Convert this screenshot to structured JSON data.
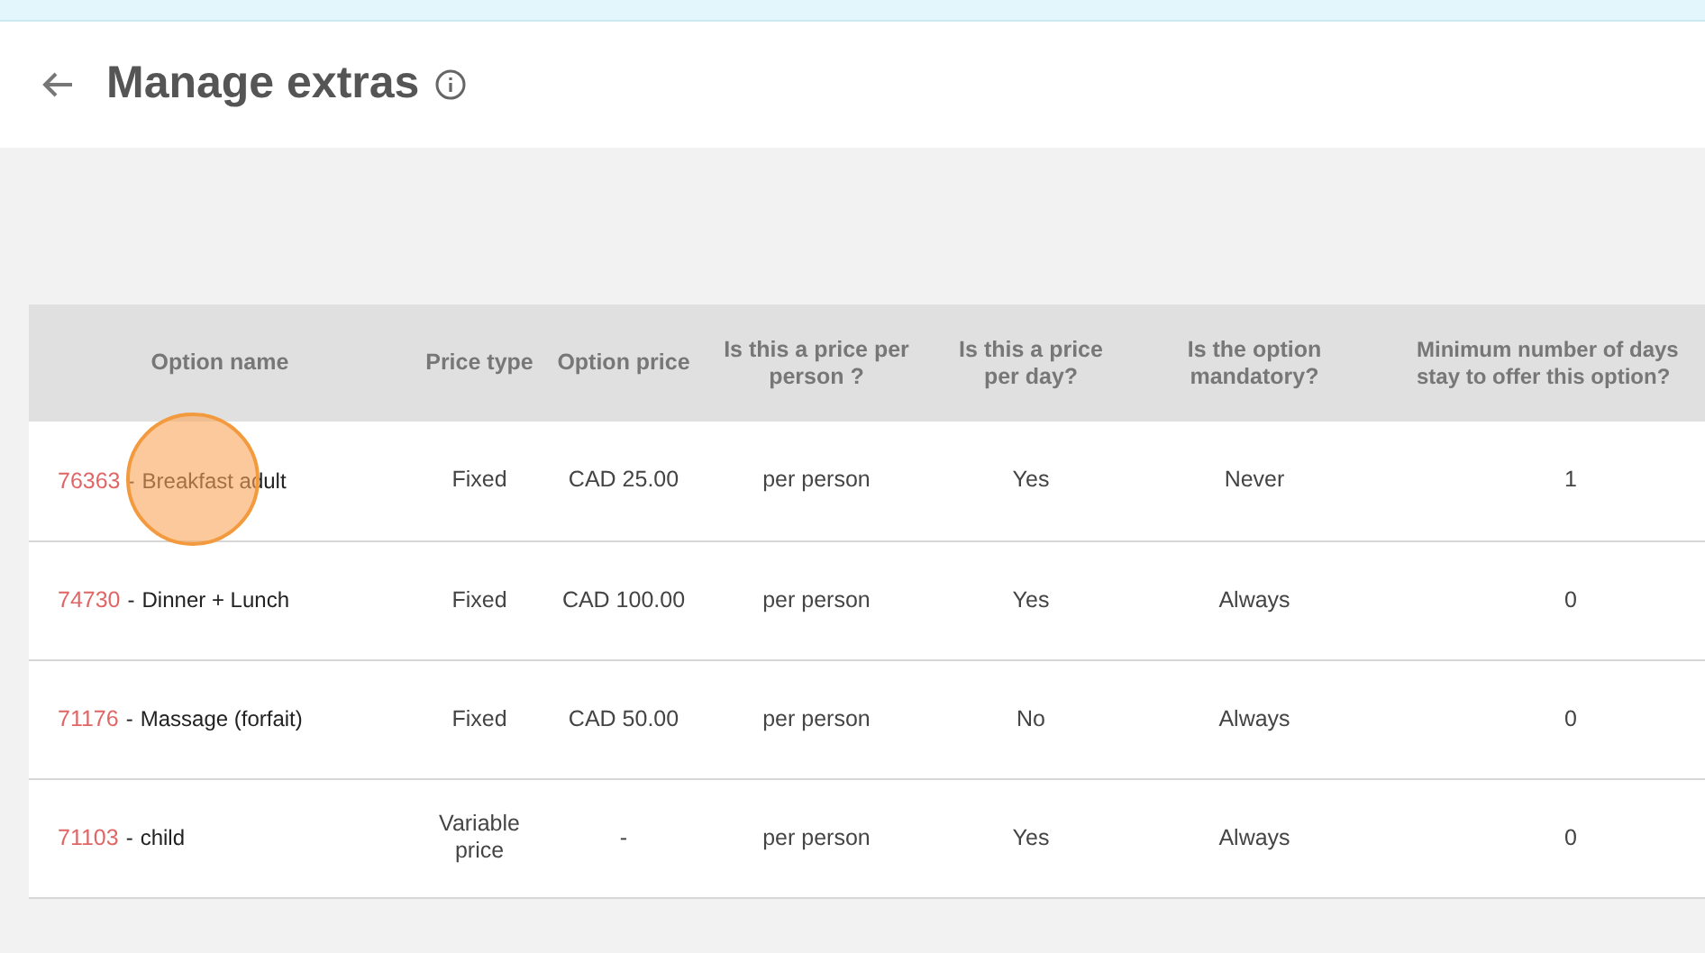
{
  "header": {
    "title": "Manage extras"
  },
  "table": {
    "columns": [
      "Option name",
      "Price type",
      "Option price",
      "Is this a price per person ?",
      "Is this a price per day?",
      "Is the option mandatory?",
      "Minimum number of days\nstay to offer this option?"
    ],
    "rows": [
      {
        "id": "76363",
        "separator": "-",
        "name": "Breakfast adult",
        "price_type": "Fixed",
        "price": "CAD 25.00",
        "per_person": "per person",
        "per_day": "Yes",
        "mandatory": "Never",
        "min_days": "1",
        "click_marker": true
      },
      {
        "id": "74730",
        "separator": "-",
        "name": "Dinner + Lunch",
        "price_type": "Fixed",
        "price": "CAD 100.00",
        "per_person": "per person",
        "per_day": "Yes",
        "mandatory": "Always",
        "min_days": "0",
        "click_marker": false
      },
      {
        "id": "71176",
        "separator": "-",
        "name": "Massage (forfait)",
        "price_type": "Fixed",
        "price": "CAD 50.00",
        "per_person": "per person",
        "per_day": "No",
        "mandatory": "Always",
        "min_days": "0",
        "click_marker": false
      },
      {
        "id": "71103",
        "separator": "-",
        "name": "child",
        "price_type": "Variable price",
        "price": "-",
        "per_person": "per person",
        "per_day": "Yes",
        "mandatory": "Always",
        "min_days": "0",
        "click_marker": false
      }
    ]
  }
}
